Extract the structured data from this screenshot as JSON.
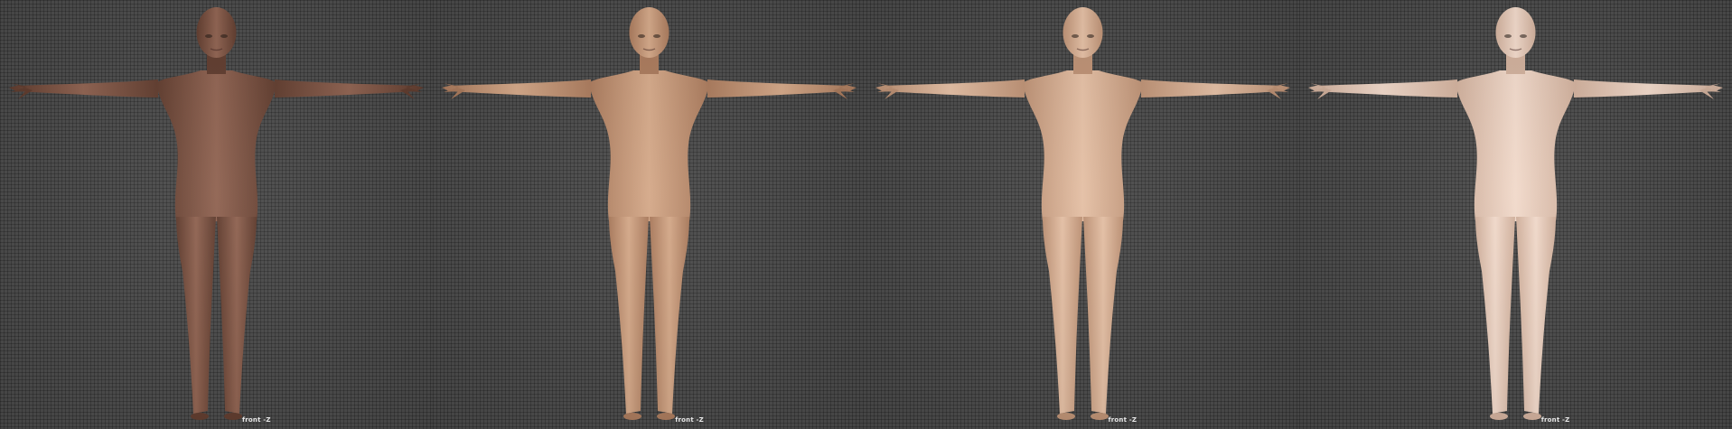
{
  "viewports": [
    {
      "label": "front -Z",
      "skin": "#7a4f3e",
      "skin_dark": "#5e3a2c",
      "skin_light": "#8f6250"
    },
    {
      "label": "front -Z",
      "skin": "#c39472",
      "skin_dark": "#a8785a",
      "skin_light": "#d4a888"
    },
    {
      "label": "front -Z",
      "skin": "#d6ac8e",
      "skin_dark": "#bb8f72",
      "skin_light": "#e4bfa4"
    },
    {
      "label": "front -Z",
      "skin": "#e6c8b6",
      "skin_dark": "#cfae9a",
      "skin_light": "#f1d9ca"
    }
  ]
}
